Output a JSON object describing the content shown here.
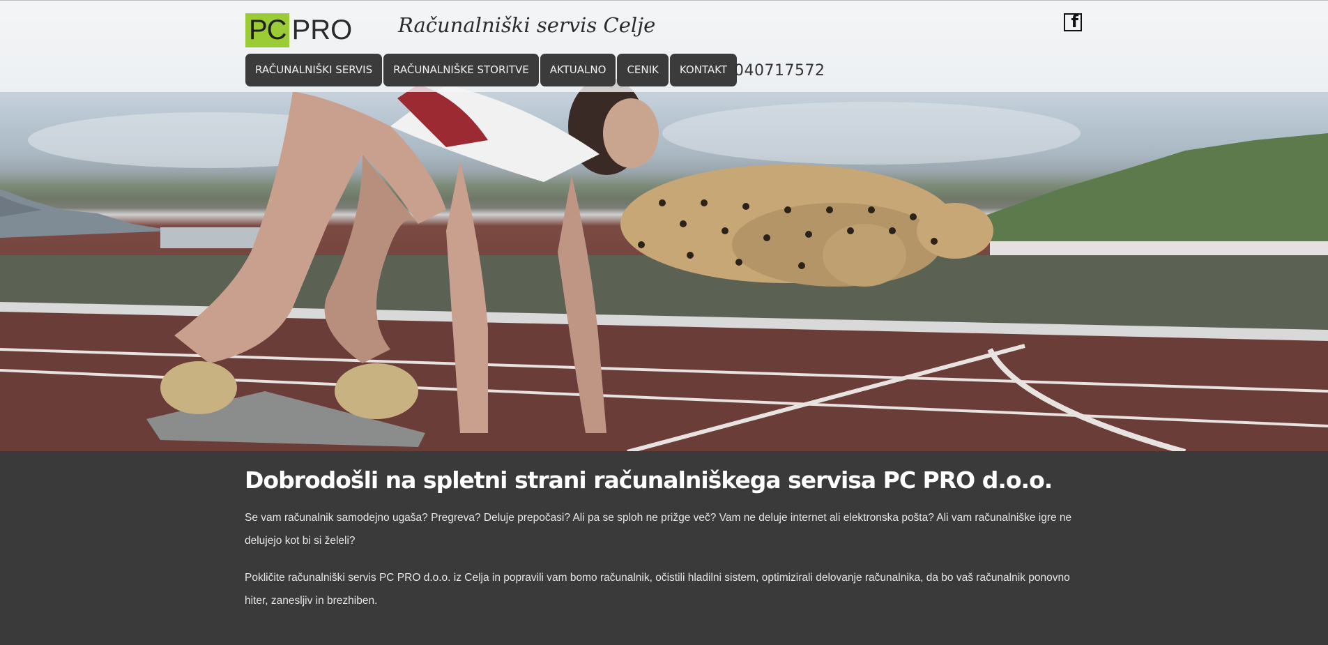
{
  "header": {
    "logo": {
      "pc": "PC",
      "pro": "PRO"
    },
    "tagline": "Računalniški servis Celje",
    "facebook_icon": "facebook-icon",
    "phone": "040717572",
    "nav": [
      {
        "label": "RAČUNALNIŠKI SERVIS"
      },
      {
        "label": "RAČUNALNIŠKE STORITVE"
      },
      {
        "label": "AKTUALNO"
      },
      {
        "label": "CENIK"
      },
      {
        "label": "KONTAKT"
      }
    ]
  },
  "main": {
    "title": "Dobrodošli na spletni strani računalniškega servisa PC PRO d.o.o.",
    "paragraphs": [
      "Se vam računalnik samodejno ugaša? Pregreva? Deluje prepočasi? Ali pa se sploh ne prižge več? Vam ne deluje internet ali elektronska pošta? Ali vam računalniške igre ne delujejo kot bi si želeli?",
      "Pokličite računalniški servis PC PRO d.o.o. iz Celja in popravili vam bomo računalnik, očistili hladilni sistem, optimizirali delovanje računalnika, da bo vaš računalnik ponovno hiter, zanesljiv in brezhiben."
    ]
  },
  "colors": {
    "logo_accent": "#9bcc35",
    "nav_bg": "#3b3b3b",
    "content_bg": "#3a3a3a"
  }
}
